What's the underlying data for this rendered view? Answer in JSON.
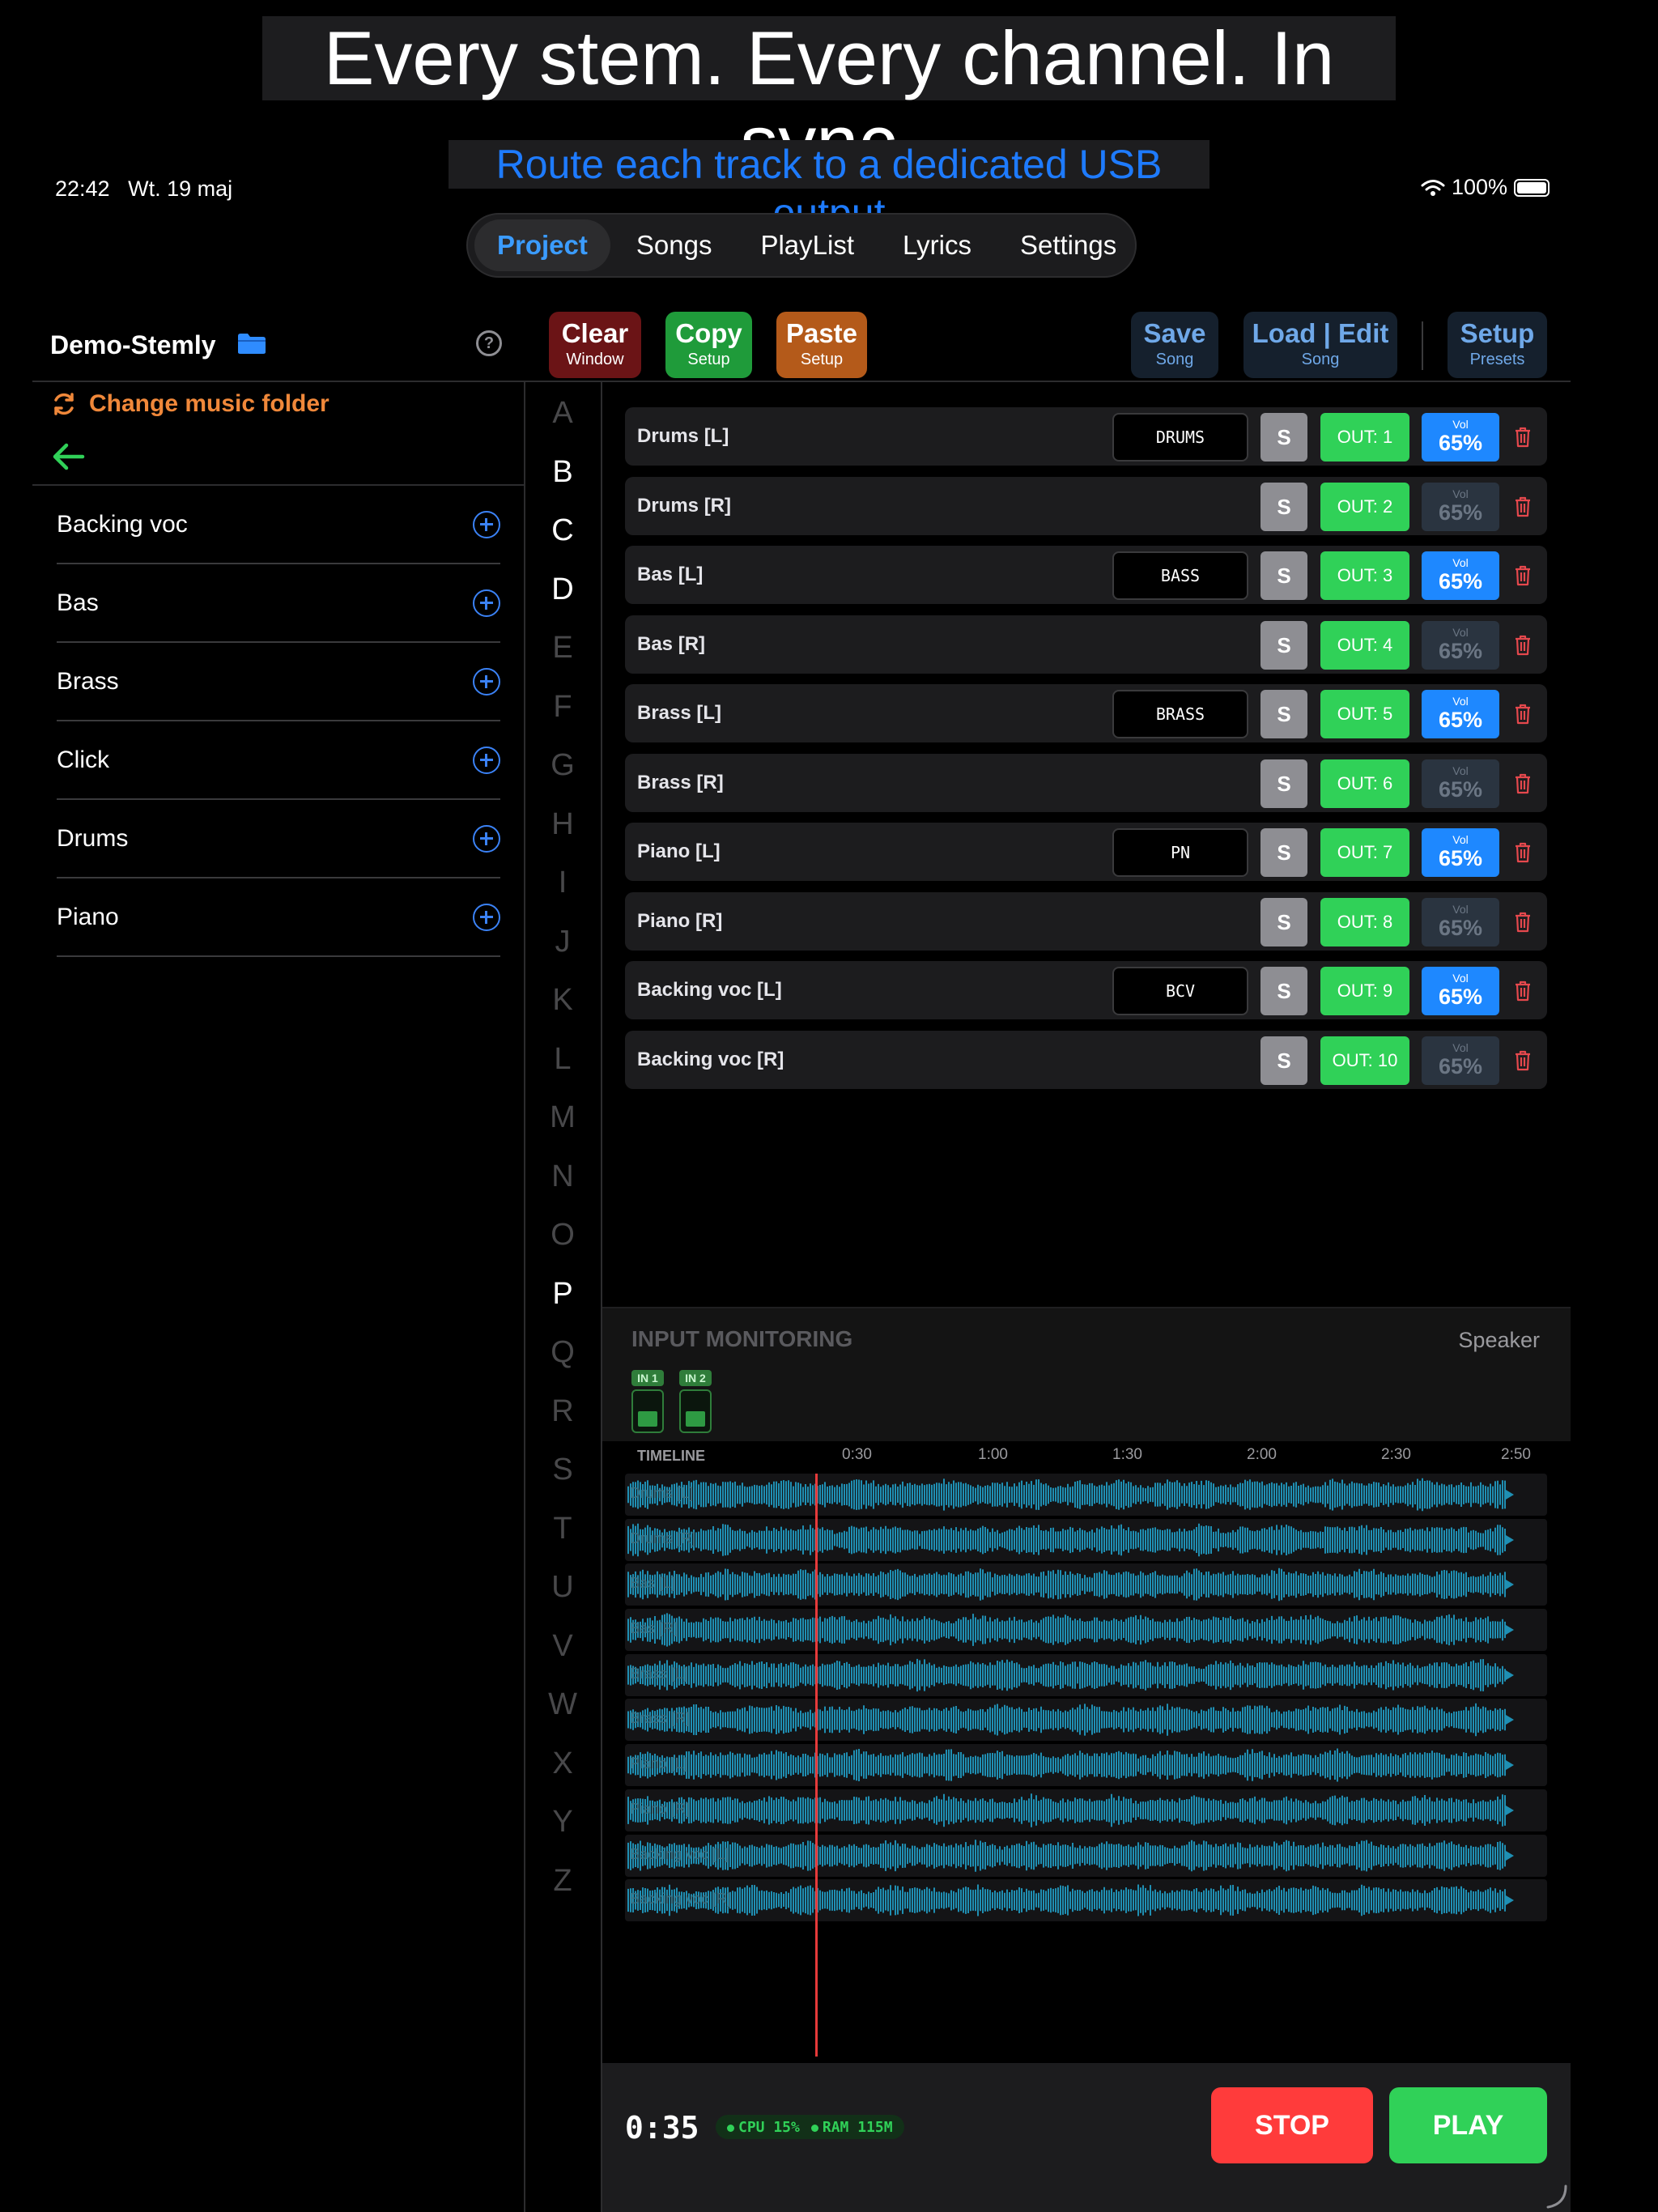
{
  "promo": {
    "headline": "Every stem. Every channel. In sync.",
    "subheadline": "Route each track to a dedicated USB output"
  },
  "status_bar": {
    "time": "22:42",
    "date": "Wt. 19 maj",
    "battery": "100%"
  },
  "nav": {
    "tabs": [
      "Project",
      "Songs",
      "PlayList",
      "Lyrics",
      "Settings"
    ],
    "active": "Project"
  },
  "sidebar": {
    "project_name": "Demo-Stemly",
    "change_folder": "Change music folder",
    "help_icon": "?",
    "items": [
      "Backing voc",
      "Bas",
      "Brass",
      "Click",
      "Drums",
      "Piano"
    ]
  },
  "alphabet": {
    "letters": [
      "A",
      "B",
      "C",
      "D",
      "E",
      "F",
      "G",
      "H",
      "I",
      "J",
      "K",
      "L",
      "M",
      "N",
      "O",
      "P",
      "Q",
      "R",
      "S",
      "T",
      "U",
      "V",
      "W",
      "X",
      "Y",
      "Z"
    ],
    "active": [
      "B",
      "C",
      "D",
      "P"
    ]
  },
  "toolbar": {
    "clear": {
      "label": "Clear",
      "sub": "Window"
    },
    "copy": {
      "label": "Copy",
      "sub": "Setup"
    },
    "paste": {
      "label": "Paste",
      "sub": "Setup"
    },
    "save": {
      "label": "Save",
      "sub": "Song"
    },
    "load": {
      "label": "Load | Edit",
      "sub": "Song"
    },
    "setup": {
      "label": "Setup",
      "sub": "Presets"
    }
  },
  "tracks": [
    {
      "name": "Drums [L]",
      "tag": "DRUMS",
      "solo": "S",
      "out": "OUT: 1",
      "vol_label": "Vol",
      "vol": "65%",
      "vol_active": true
    },
    {
      "name": "Drums [R]",
      "tag": "",
      "solo": "S",
      "out": "OUT: 2",
      "vol_label": "Vol",
      "vol": "65%",
      "vol_active": false
    },
    {
      "name": "Bas [L]",
      "tag": "BASS",
      "solo": "S",
      "out": "OUT: 3",
      "vol_label": "Vol",
      "vol": "65%",
      "vol_active": true
    },
    {
      "name": "Bas [R]",
      "tag": "",
      "solo": "S",
      "out": "OUT: 4",
      "vol_label": "Vol",
      "vol": "65%",
      "vol_active": false
    },
    {
      "name": "Brass [L]",
      "tag": "BRASS",
      "solo": "S",
      "out": "OUT: 5",
      "vol_label": "Vol",
      "vol": "65%",
      "vol_active": true
    },
    {
      "name": "Brass [R]",
      "tag": "",
      "solo": "S",
      "out": "OUT: 6",
      "vol_label": "Vol",
      "vol": "65%",
      "vol_active": false
    },
    {
      "name": "Piano [L]",
      "tag": "PN",
      "solo": "S",
      "out": "OUT: 7",
      "vol_label": "Vol",
      "vol": "65%",
      "vol_active": true
    },
    {
      "name": "Piano [R]",
      "tag": "",
      "solo": "S",
      "out": "OUT: 8",
      "vol_label": "Vol",
      "vol": "65%",
      "vol_active": false
    },
    {
      "name": "Backing voc [L]",
      "tag": "BCV",
      "solo": "S",
      "out": "OUT: 9",
      "vol_label": "Vol",
      "vol": "65%",
      "vol_active": true
    },
    {
      "name": "Backing voc [R]",
      "tag": "",
      "solo": "S",
      "out": "OUT: 10",
      "vol_label": "Vol",
      "vol": "65%",
      "vol_active": false
    }
  ],
  "monitoring": {
    "title": "INPUT MONITORING",
    "route": "Speaker",
    "inputs": [
      {
        "label": "IN 1",
        "level": 0.45
      },
      {
        "label": "IN 2",
        "level": 0.45
      }
    ]
  },
  "timeline": {
    "label": "TIMELINE",
    "ticks": [
      "0:30",
      "1:00",
      "1:30",
      "2:00",
      "2:30",
      "2:50"
    ],
    "lanes": [
      "Drums [L]",
      "Drums [R]",
      "Bas [L]",
      "Bas [R]",
      "Brass [L]",
      "Brass [R]",
      "Piano [L]",
      "Piano [R]",
      "Backing voc [L]",
      "Backing voc [R]"
    ]
  },
  "transport": {
    "time": "0:35",
    "cpu": "CPU 15%",
    "ram": "RAM 115M",
    "stop": "STOP",
    "play": "PLAY"
  },
  "colors": {
    "accent_blue": "#1e88ff",
    "output_green": "#30d158",
    "stop_red": "#ff3b3b",
    "folder_orange": "#f0883a",
    "waveform": "#1f8fb3"
  }
}
